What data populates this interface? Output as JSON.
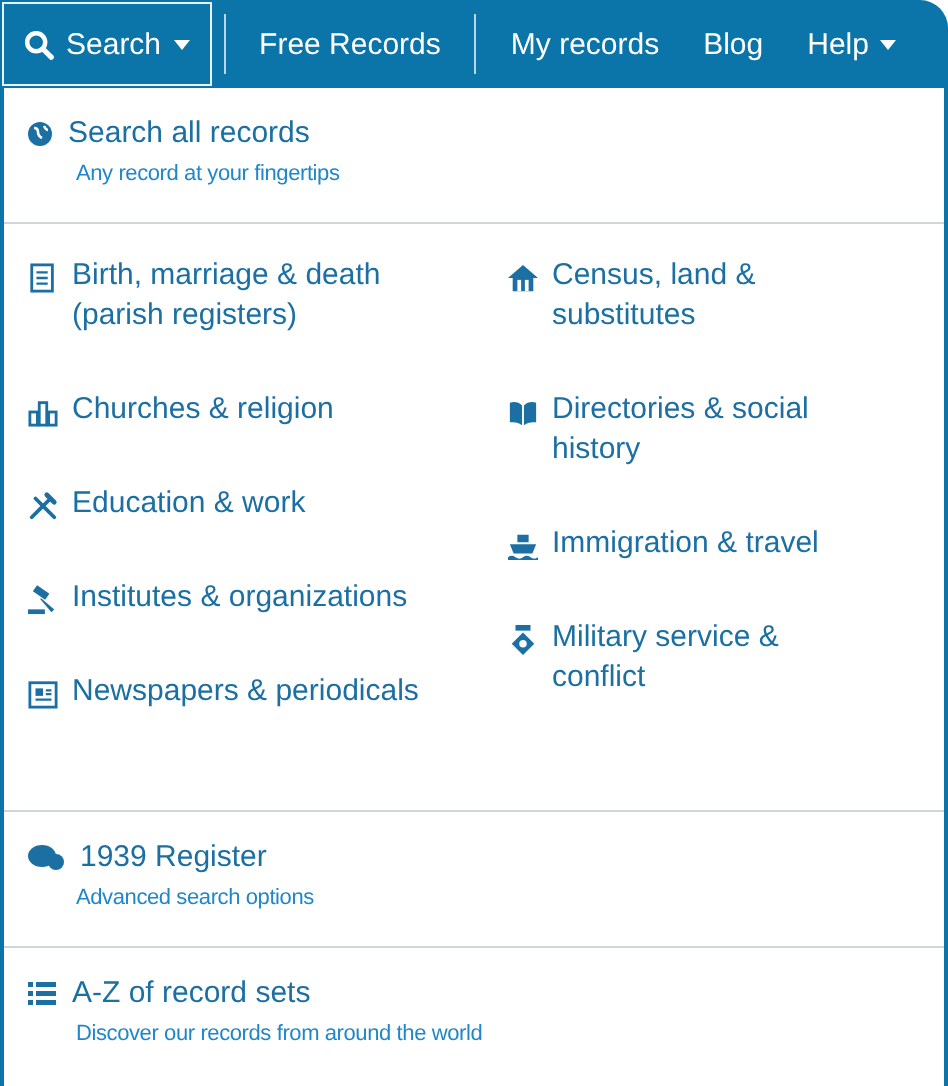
{
  "nav": [
    {
      "label": "Search",
      "selected": true,
      "has_menu": true,
      "divider_after": true
    },
    {
      "label": "Free Records",
      "selected": false,
      "has_menu": false,
      "divider_after": true
    },
    {
      "label": "My records",
      "selected": false,
      "has_menu": false,
      "divider_after": false
    },
    {
      "label": "Blog",
      "selected": false,
      "has_menu": false,
      "divider_after": false
    },
    {
      "label": "Help",
      "selected": false,
      "has_menu": true,
      "divider_after": false
    }
  ],
  "search_all": {
    "title": "Search all records",
    "subtitle": "Any record at your fingertips"
  },
  "categories": [
    {
      "label": "Birth, marriage & death (parish registers)"
    },
    {
      "label": "Census, land & substitutes"
    },
    {
      "label": "Churches & religion"
    },
    {
      "label": "Directories & social history"
    },
    {
      "label": "Education & work"
    },
    {
      "label": "Immigration & travel"
    },
    {
      "label": "Institutes & organizations"
    },
    {
      "label": "Military service & conflict"
    },
    {
      "label": "Newspapers & periodicals"
    }
  ],
  "register": {
    "title": "1939 Register",
    "subtitle": "Advanced search options"
  },
  "az": {
    "title": "A-Z of record sets",
    "subtitle": "Discover our records from around the world"
  }
}
